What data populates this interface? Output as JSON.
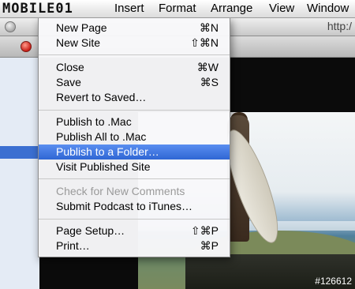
{
  "menubar": {
    "logo_text": "MOBILE01",
    "items": [
      {
        "label": "Insert"
      },
      {
        "label": "Format"
      },
      {
        "label": "Arrange"
      },
      {
        "label": "View"
      },
      {
        "label": "Window"
      }
    ]
  },
  "window": {
    "url_fragment": "http:/"
  },
  "file_menu": {
    "groups": [
      [
        {
          "label": "New Page",
          "shortcut": "⌘N"
        },
        {
          "label": "New Site",
          "shortcut": "⇧⌘N"
        }
      ],
      [
        {
          "label": "Close",
          "shortcut": "⌘W"
        },
        {
          "label": "Save",
          "shortcut": "⌘S"
        },
        {
          "label": "Revert to Saved…",
          "shortcut": ""
        }
      ],
      [
        {
          "label": "Publish to .Mac",
          "shortcut": ""
        },
        {
          "label": "Publish All to .Mac",
          "shortcut": ""
        },
        {
          "label": "Publish to a Folder…",
          "shortcut": "",
          "highlighted": true
        },
        {
          "label": "Visit Published Site",
          "shortcut": ""
        }
      ],
      [
        {
          "label": "Check for New Comments",
          "shortcut": "",
          "disabled": true
        },
        {
          "label": "Submit Podcast to iTunes…",
          "shortcut": ""
        }
      ],
      [
        {
          "label": "Page Setup…",
          "shortcut": "⇧⌘P"
        },
        {
          "label": "Print…",
          "shortcut": "⌘P"
        }
      ]
    ]
  },
  "watermark": "#126612",
  "colors": {
    "highlight": "#2f66d4",
    "menu_bg": "#f8f8fa",
    "disabled_text": "#9a9a9a"
  }
}
